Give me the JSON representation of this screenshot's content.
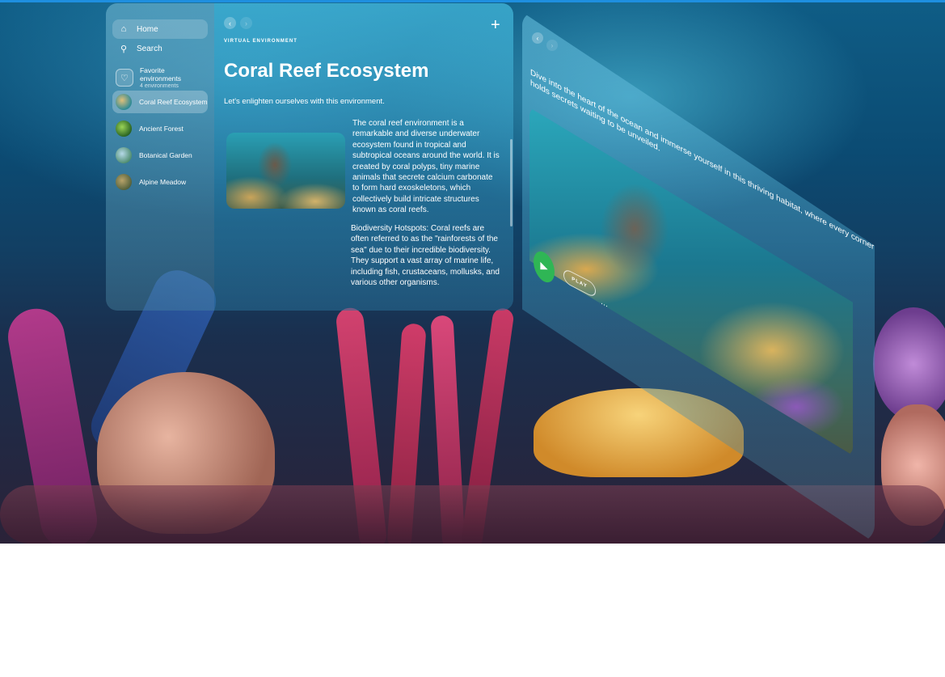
{
  "sidebar": {
    "home_label": "Home",
    "search_label": "Search",
    "favorites": {
      "title": "Favorite environments",
      "count": "4 environments"
    },
    "items": [
      {
        "label": "Coral Reef Ecosystem",
        "active": true
      },
      {
        "label": "Ancient Forest",
        "active": false
      },
      {
        "label": "Botanical Garden",
        "active": false
      },
      {
        "label": "Alpine Meadow",
        "active": false
      }
    ]
  },
  "main": {
    "overline": "VIRTUAL ENVIRONMENT",
    "title": "Coral Reef Ecosystem",
    "subtitle": "Let's enlighten ourselves with this environment.",
    "paragraph1": "The coral reef environment is a remarkable and diverse underwater ecosystem found in tropical and subtropical oceans around the world. It is created by coral polyps, tiny marine animals that secrete calcium carbonate to form hard exoskeletons, which collectively build intricate structures known as coral reefs.",
    "paragraph2": "Biodiversity Hotspots: Coral reefs are often referred to as the \"rainforests of the sea\" due to their incredible biodiversity. They support a vast array of marine life, including fish, crustaceans, mollusks, and various other organisms."
  },
  "preview": {
    "description": "Dive into the heart of the ocean and immerse yourself in this thriving habitat, where every corner holds secrets waiting to be unveiled.",
    "play_label": "PLAY",
    "more_label": "⋯"
  },
  "icons": {
    "home": "home-icon",
    "search": "search-icon",
    "heart": "heart-icon",
    "back": "chevron-left-icon",
    "forward": "chevron-right-icon",
    "add": "plus-icon",
    "play": "play-icon"
  },
  "colors": {
    "accent": "#1e8fe0",
    "play_button": "#2fb655"
  }
}
